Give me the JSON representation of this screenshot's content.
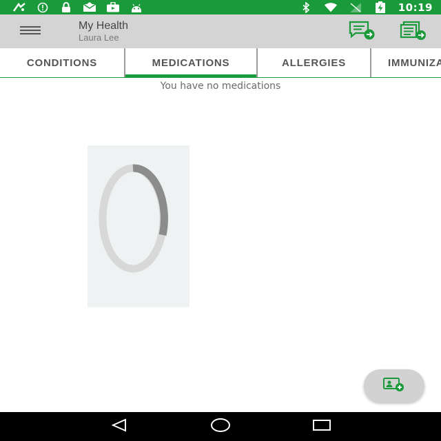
{
  "status_bar": {
    "time": "10:19",
    "left_icons": [
      "fax-icon",
      "alert-circle-icon",
      "lock-icon",
      "mail-icon",
      "briefcase-icon",
      "android-icon"
    ],
    "right_icons": [
      "bluetooth-icon",
      "wifi-icon",
      "signal-icon",
      "battery-charging-icon"
    ]
  },
  "app_bar": {
    "title": "My Health",
    "subtitle": "Laura Lee",
    "actions": [
      "message-forward-icon",
      "document-forward-icon"
    ]
  },
  "tabs": [
    {
      "label": "CONDITIONS",
      "active": false
    },
    {
      "label": "MEDICATIONS",
      "active": true
    },
    {
      "label": "ALLERGIES",
      "active": false
    },
    {
      "label": "IMMUNIZATIONS",
      "active": false
    }
  ],
  "content": {
    "empty_message": "You have no medications"
  },
  "fab": {
    "icon": "add-card-icon"
  },
  "nav": [
    "back-icon",
    "home-icon",
    "recents-icon"
  ],
  "colors": {
    "accent": "#1a9a3a",
    "app_bar_bg": "#d4d4d4",
    "spinner_track": "#d8d8d8",
    "spinner_arc": "#8c8c8c"
  }
}
